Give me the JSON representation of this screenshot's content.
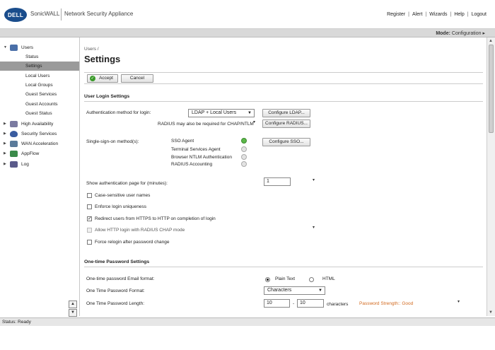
{
  "header": {
    "logo_text": "DELL",
    "brand": "SonicWALL",
    "product": "Network Security Appliance",
    "links": [
      "Register",
      "Alert",
      "Wizards",
      "Help",
      "Logout"
    ]
  },
  "modebar": {
    "label": "Mode:",
    "value": "Configuration ▸"
  },
  "sidebar": {
    "items": [
      {
        "label": "Users",
        "level": 0,
        "expanded": true,
        "color": "#4a6fa8"
      },
      {
        "label": "Status",
        "level": 1
      },
      {
        "label": "Settings",
        "level": 1,
        "selected": true
      },
      {
        "label": "Local Users",
        "level": 1
      },
      {
        "label": "Local Groups",
        "level": 1
      },
      {
        "label": "Guest Services",
        "level": 1
      },
      {
        "label": "Guest Accounts",
        "level": 1
      },
      {
        "label": "Guest Status",
        "level": 1
      },
      {
        "label": "High Availability",
        "level": 0,
        "color": "#7a7aa0"
      },
      {
        "label": "Security Services",
        "level": 0,
        "color": "#3a5ca0"
      },
      {
        "label": "WAN Acceleration",
        "level": 0,
        "color": "#5a7a9a"
      },
      {
        "label": "AppFlow",
        "level": 0,
        "color": "#3a8a4a"
      },
      {
        "label": "Log",
        "level": 0,
        "color": "#5a5a8a"
      }
    ]
  },
  "page": {
    "breadcrumb": "Users /",
    "title": "Settings",
    "accept_label": "Accept",
    "cancel_label": "Cancel"
  },
  "login": {
    "section_title": "User Login Settings",
    "auth_method_label": "Authentication method for login:",
    "auth_method_value": "LDAP + Local Users",
    "configure_ldap": "Configure LDAP...",
    "radius_note": "RADIUS may also be required for CHAP/NTLM",
    "configure_radius": "Configure RADIUS...",
    "sso_label": "Single-sign-on method(s):",
    "sso_methods": [
      {
        "label": "SSO Agent",
        "status": "ok"
      },
      {
        "label": "Terminal Services Agent",
        "status": "off"
      },
      {
        "label": "Browser NTLM Authentication",
        "status": "off"
      },
      {
        "label": "RADIUS Accounting",
        "status": "off"
      }
    ],
    "configure_sso": "Configure SSO...",
    "show_auth_label": "Show authentication page for (minutes):",
    "show_auth_value": "1",
    "options": [
      {
        "label": "Case-sensitive user names",
        "checked": false,
        "disabled": false
      },
      {
        "label": "Enforce login uniqueness",
        "checked": false,
        "disabled": false
      },
      {
        "label": "Redirect users from HTTPS to HTTP on completion of login",
        "checked": true,
        "disabled": false
      },
      {
        "label": "Allow HTTP login with RADIUS CHAP mode",
        "checked": false,
        "disabled": true
      },
      {
        "label": "Force relogin after password change",
        "checked": false,
        "disabled": false
      }
    ]
  },
  "otp": {
    "section_title": "One-time Password Settings",
    "email_format_label": "One-time password Email format:",
    "format_plain": "Plain Text",
    "format_html": "HTML",
    "format_selected": "plain",
    "otp_format_label": "One Time Password Format:",
    "otp_format_value": "Characters",
    "length_label": "One Time Password Length:",
    "length_min": "10",
    "length_sep": "-",
    "length_max": "10",
    "length_unit": "characters",
    "strength_label": "Password Strength:: Good",
    "strength_color": "#d2691e"
  },
  "statusbar": {
    "text": "Status: Ready"
  }
}
